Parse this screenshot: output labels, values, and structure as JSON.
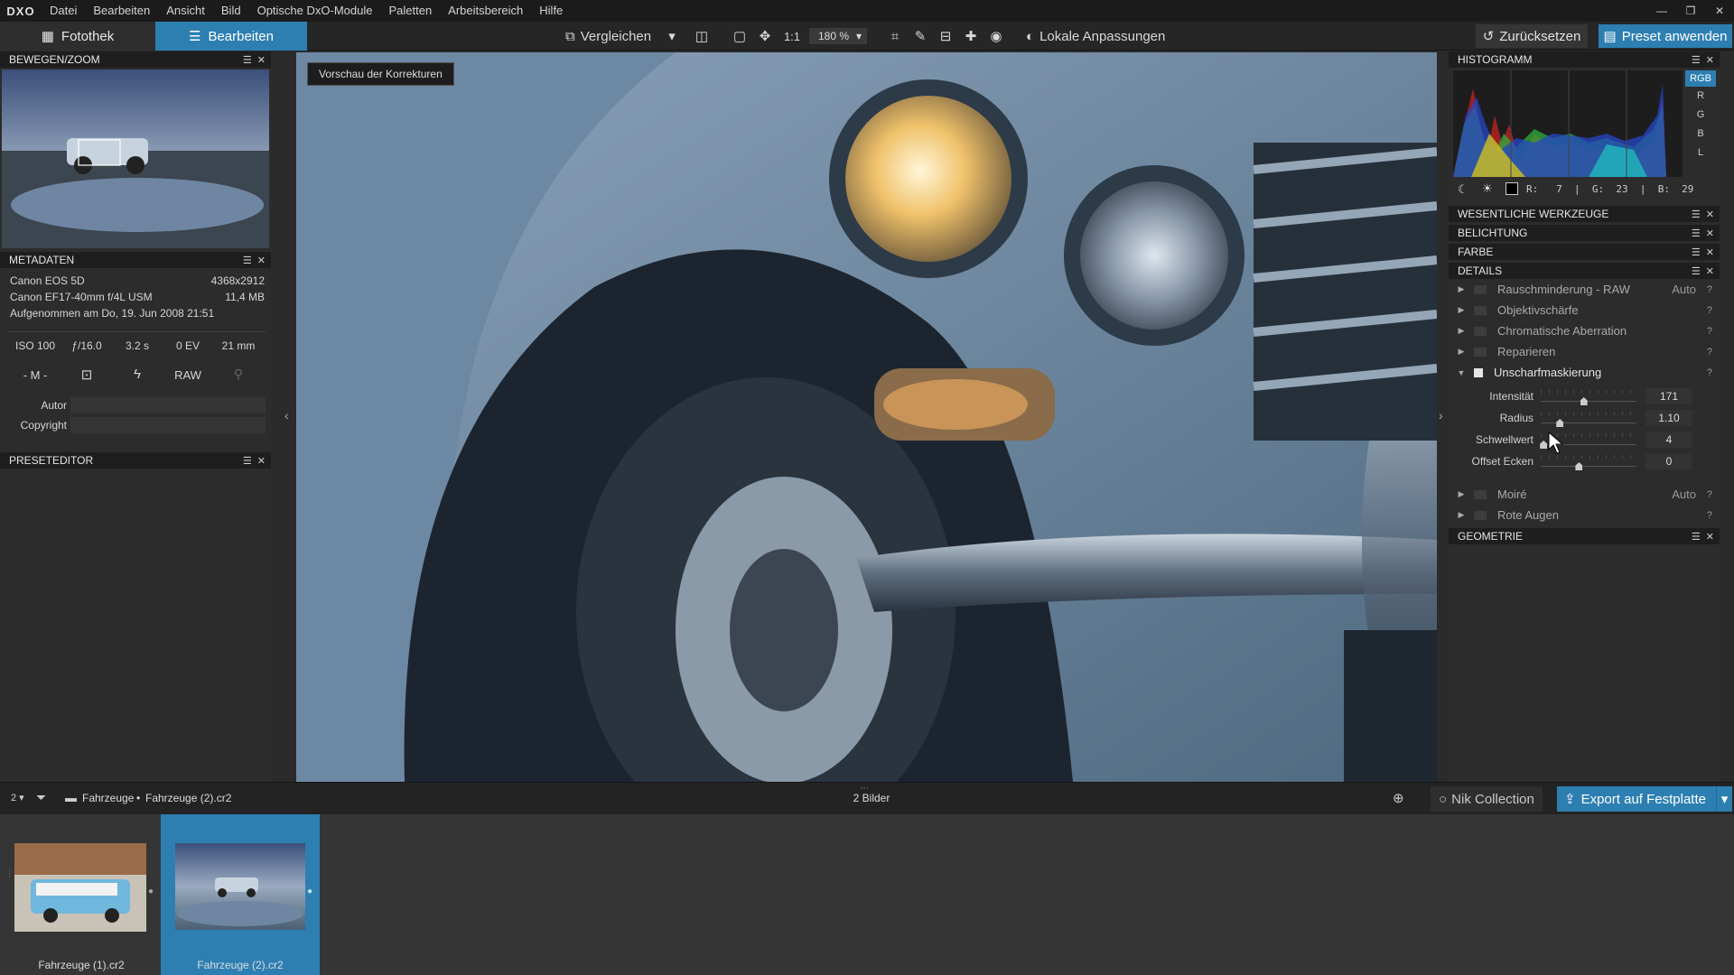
{
  "app": {
    "logo": "DXO"
  },
  "menu": [
    "Datei",
    "Bearbeiten",
    "Ansicht",
    "Bild",
    "Optische DxO-Module",
    "Paletten",
    "Arbeitsbereich",
    "Hilfe"
  ],
  "toolbar": {
    "tab_library": "Fotothek",
    "tab_edit": "Bearbeiten",
    "compare": "Vergleichen",
    "zoom_1to1": "1:1",
    "zoom_value": "180 %",
    "local_adjust": "Lokale Anpassungen",
    "reset": "Zurücksetzen",
    "apply_preset": "Preset anwenden"
  },
  "left": {
    "movezoom_title": "BEWEGEN/ZOOM",
    "metadata_title": "METADATEN",
    "camera": "Canon EOS 5D",
    "resolution": "4368x2912",
    "lens": "Canon EF17-40mm f/4L USM",
    "filesize": "11,4 MB",
    "date": "Aufgenommen am Do, 19. Jun 2008 21:51",
    "exif": [
      "ISO 100",
      "ƒ/16.0",
      "3.2 s",
      "0 EV",
      "21 mm"
    ],
    "mode": "- M -",
    "raw": "RAW",
    "author_label": "Autor",
    "copyright_label": "Copyright",
    "preseteditor_title": "PRESETEDITOR"
  },
  "main": {
    "preview_badge": "Vorschau der Korrekturen"
  },
  "right": {
    "histogram_title": "HISTOGRAMM",
    "channels": [
      "RGB",
      "R",
      "G",
      "B",
      "L"
    ],
    "rgb_readout": "R:   7  |  G:  23  |  B:  29",
    "sections": [
      "WESENTLICHE WERKZEUGE",
      "BELICHTUNG",
      "FARBE",
      "DETAILS"
    ],
    "tools": [
      {
        "label": "Rauschminderung - RAW",
        "auto": "Auto",
        "q": "?"
      },
      {
        "label": "Objektivschärfe",
        "auto": "",
        "q": "?"
      },
      {
        "label": "Chromatische Aberration",
        "auto": "",
        "q": "?"
      },
      {
        "label": "Reparieren",
        "auto": "",
        "q": "?"
      },
      {
        "label": "Unscharfmaskierung",
        "auto": "",
        "q": "?"
      }
    ],
    "sliders": [
      {
        "label": "Intensität",
        "value": "171",
        "level": 0.45
      },
      {
        "label": "Radius",
        "value": "1.10",
        "level": 0.2
      },
      {
        "label": "Schwellwert",
        "value": "4",
        "level": 0.03
      },
      {
        "label": "Offset Ecken",
        "value": "0",
        "level": 0.4
      }
    ],
    "tools2": [
      {
        "label": "Moiré",
        "auto": "Auto",
        "q": "?"
      },
      {
        "label": "Rote Augen",
        "auto": "",
        "q": "?"
      }
    ],
    "geometry_title": "GEOMETRIE"
  },
  "filmbar": {
    "sort": "2",
    "path_folder": "Fahrzeuge",
    "path_sep": "•",
    "path_file": "Fahrzeuge (2).cr2",
    "count": "2 Bilder",
    "nik": "Nik Collection",
    "export": "Export auf Festplatte"
  },
  "thumbs": [
    {
      "label": "Fahrzeuge (1).cr2"
    },
    {
      "label": "Fahrzeuge (2).cr2"
    }
  ],
  "colors": {
    "accent": "#2d7fb2"
  }
}
